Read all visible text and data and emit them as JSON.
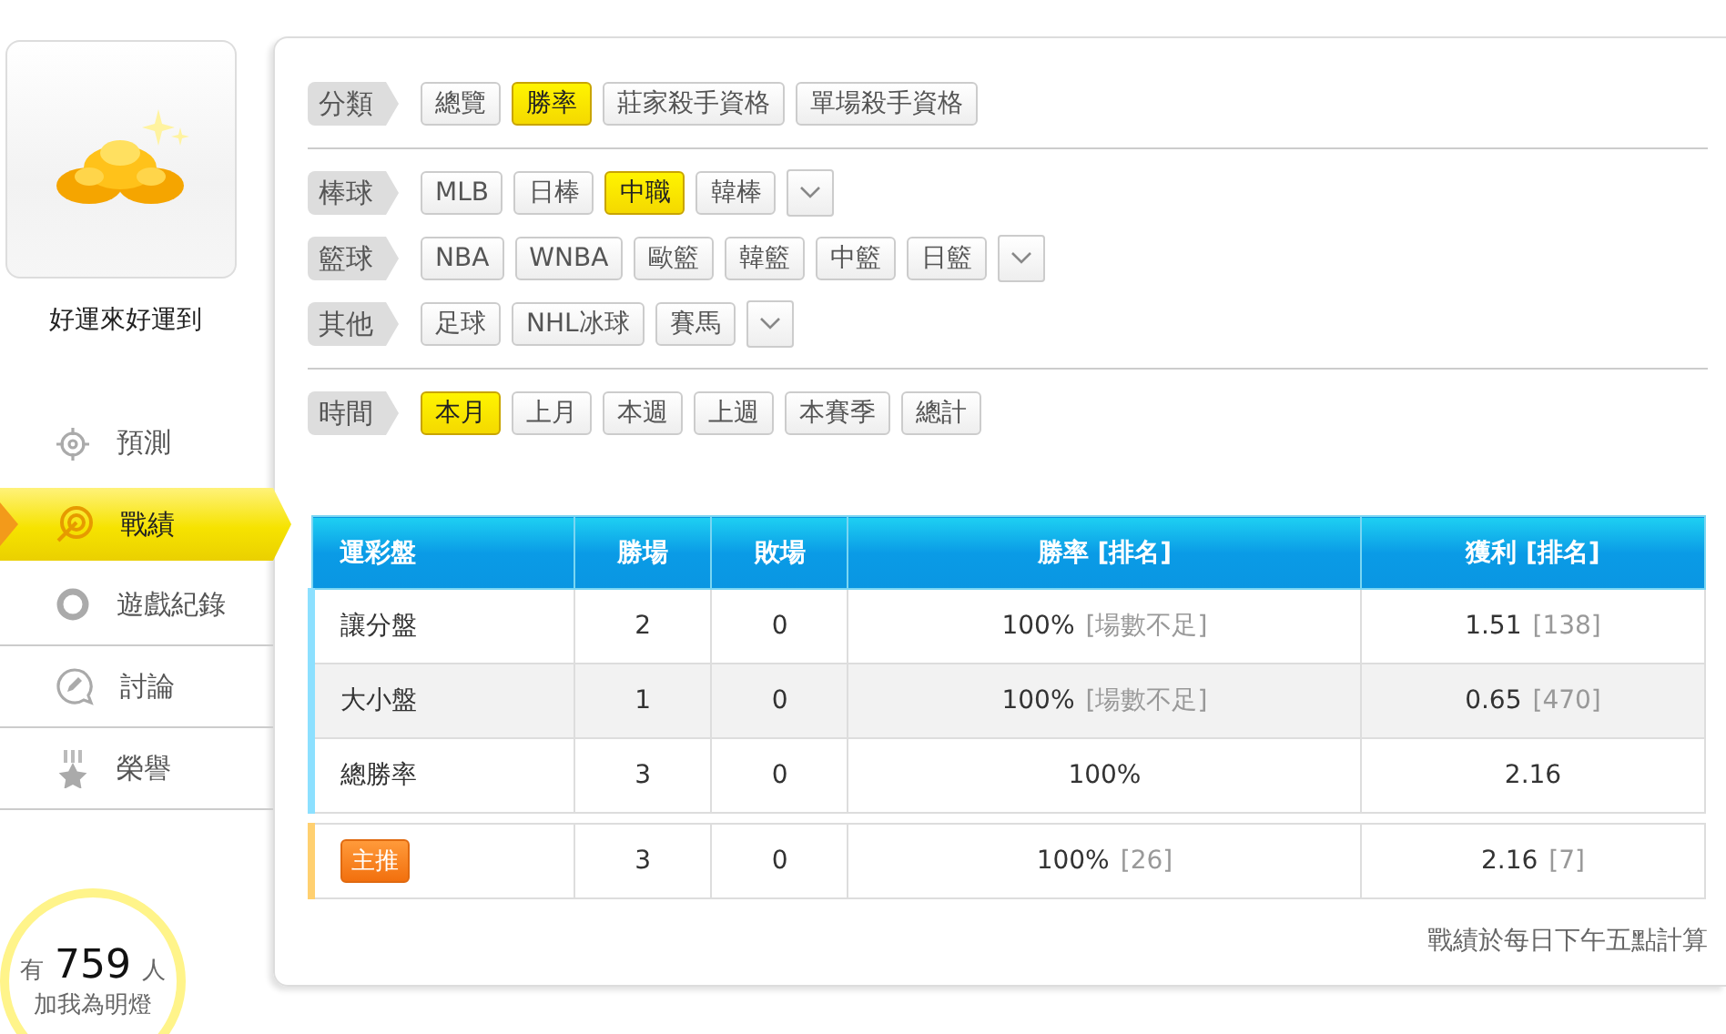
{
  "profile": {
    "name": "好運來好運到"
  },
  "nav": [
    {
      "label": "預測",
      "selected": false
    },
    {
      "label": "戰績",
      "selected": true
    },
    {
      "label": "遊戲紀錄",
      "selected": false
    },
    {
      "label": "討論",
      "selected": false
    },
    {
      "label": "榮譽",
      "selected": false
    }
  ],
  "fans": {
    "prefix": "有",
    "count": "759",
    "suffix": "人",
    "caption": "加我為明燈"
  },
  "filters": [
    {
      "label": "分類",
      "more": false,
      "divider": true,
      "options": [
        {
          "label": "總覽",
          "selected": false
        },
        {
          "label": "勝率",
          "selected": true
        },
        {
          "label": "莊家殺手資格",
          "selected": false
        },
        {
          "label": "單場殺手資格",
          "selected": false
        }
      ]
    },
    {
      "label": "棒球",
      "more": true,
      "divider": false,
      "options": [
        {
          "label": "MLB",
          "selected": false
        },
        {
          "label": "日棒",
          "selected": false
        },
        {
          "label": "中職",
          "selected": true
        },
        {
          "label": "韓棒",
          "selected": false
        }
      ]
    },
    {
      "label": "籃球",
      "more": true,
      "divider": false,
      "options": [
        {
          "label": "NBA",
          "selected": false
        },
        {
          "label": "WNBA",
          "selected": false
        },
        {
          "label": "歐籃",
          "selected": false
        },
        {
          "label": "韓籃",
          "selected": false
        },
        {
          "label": "中籃",
          "selected": false
        },
        {
          "label": "日籃",
          "selected": false
        }
      ]
    },
    {
      "label": "其他",
      "more": true,
      "divider": true,
      "options": [
        {
          "label": "足球",
          "selected": false
        },
        {
          "label": "NHL冰球",
          "selected": false
        },
        {
          "label": "賽馬",
          "selected": false
        }
      ]
    },
    {
      "label": "時間",
      "more": false,
      "divider": false,
      "options": [
        {
          "label": "本月",
          "selected": true
        },
        {
          "label": "上月",
          "selected": false
        },
        {
          "label": "本週",
          "selected": false
        },
        {
          "label": "上週",
          "selected": false
        },
        {
          "label": "本賽季",
          "selected": false
        },
        {
          "label": "總計",
          "selected": false
        }
      ]
    }
  ],
  "table": {
    "columns": [
      "運彩盤",
      "勝場",
      "敗場",
      "勝率 [排名]",
      "獲利 [排名]"
    ],
    "rows": [
      {
        "kind": "normal",
        "label": "讓分盤",
        "wins": "2",
        "losses": "0",
        "rate": "100%",
        "rate_rank": "[場數不足]",
        "profit": "1.51",
        "profit_rank": "[138]"
      },
      {
        "kind": "normal",
        "label": "大小盤",
        "wins": "1",
        "losses": "0",
        "rate": "100%",
        "rate_rank": "[場數不足]",
        "profit": "0.65",
        "profit_rank": "[470]"
      },
      {
        "kind": "normal",
        "label": "總勝率",
        "wins": "3",
        "losses": "0",
        "rate": "100%",
        "profit": "2.16"
      },
      {
        "kind": "badge",
        "label": "主推",
        "wins": "3",
        "losses": "0",
        "rate": "100%",
        "rate_rank": "[26]",
        "profit": "2.16",
        "profit_rank": "[7]"
      }
    ]
  },
  "footnote": "戰績於每日下午五點計算"
}
